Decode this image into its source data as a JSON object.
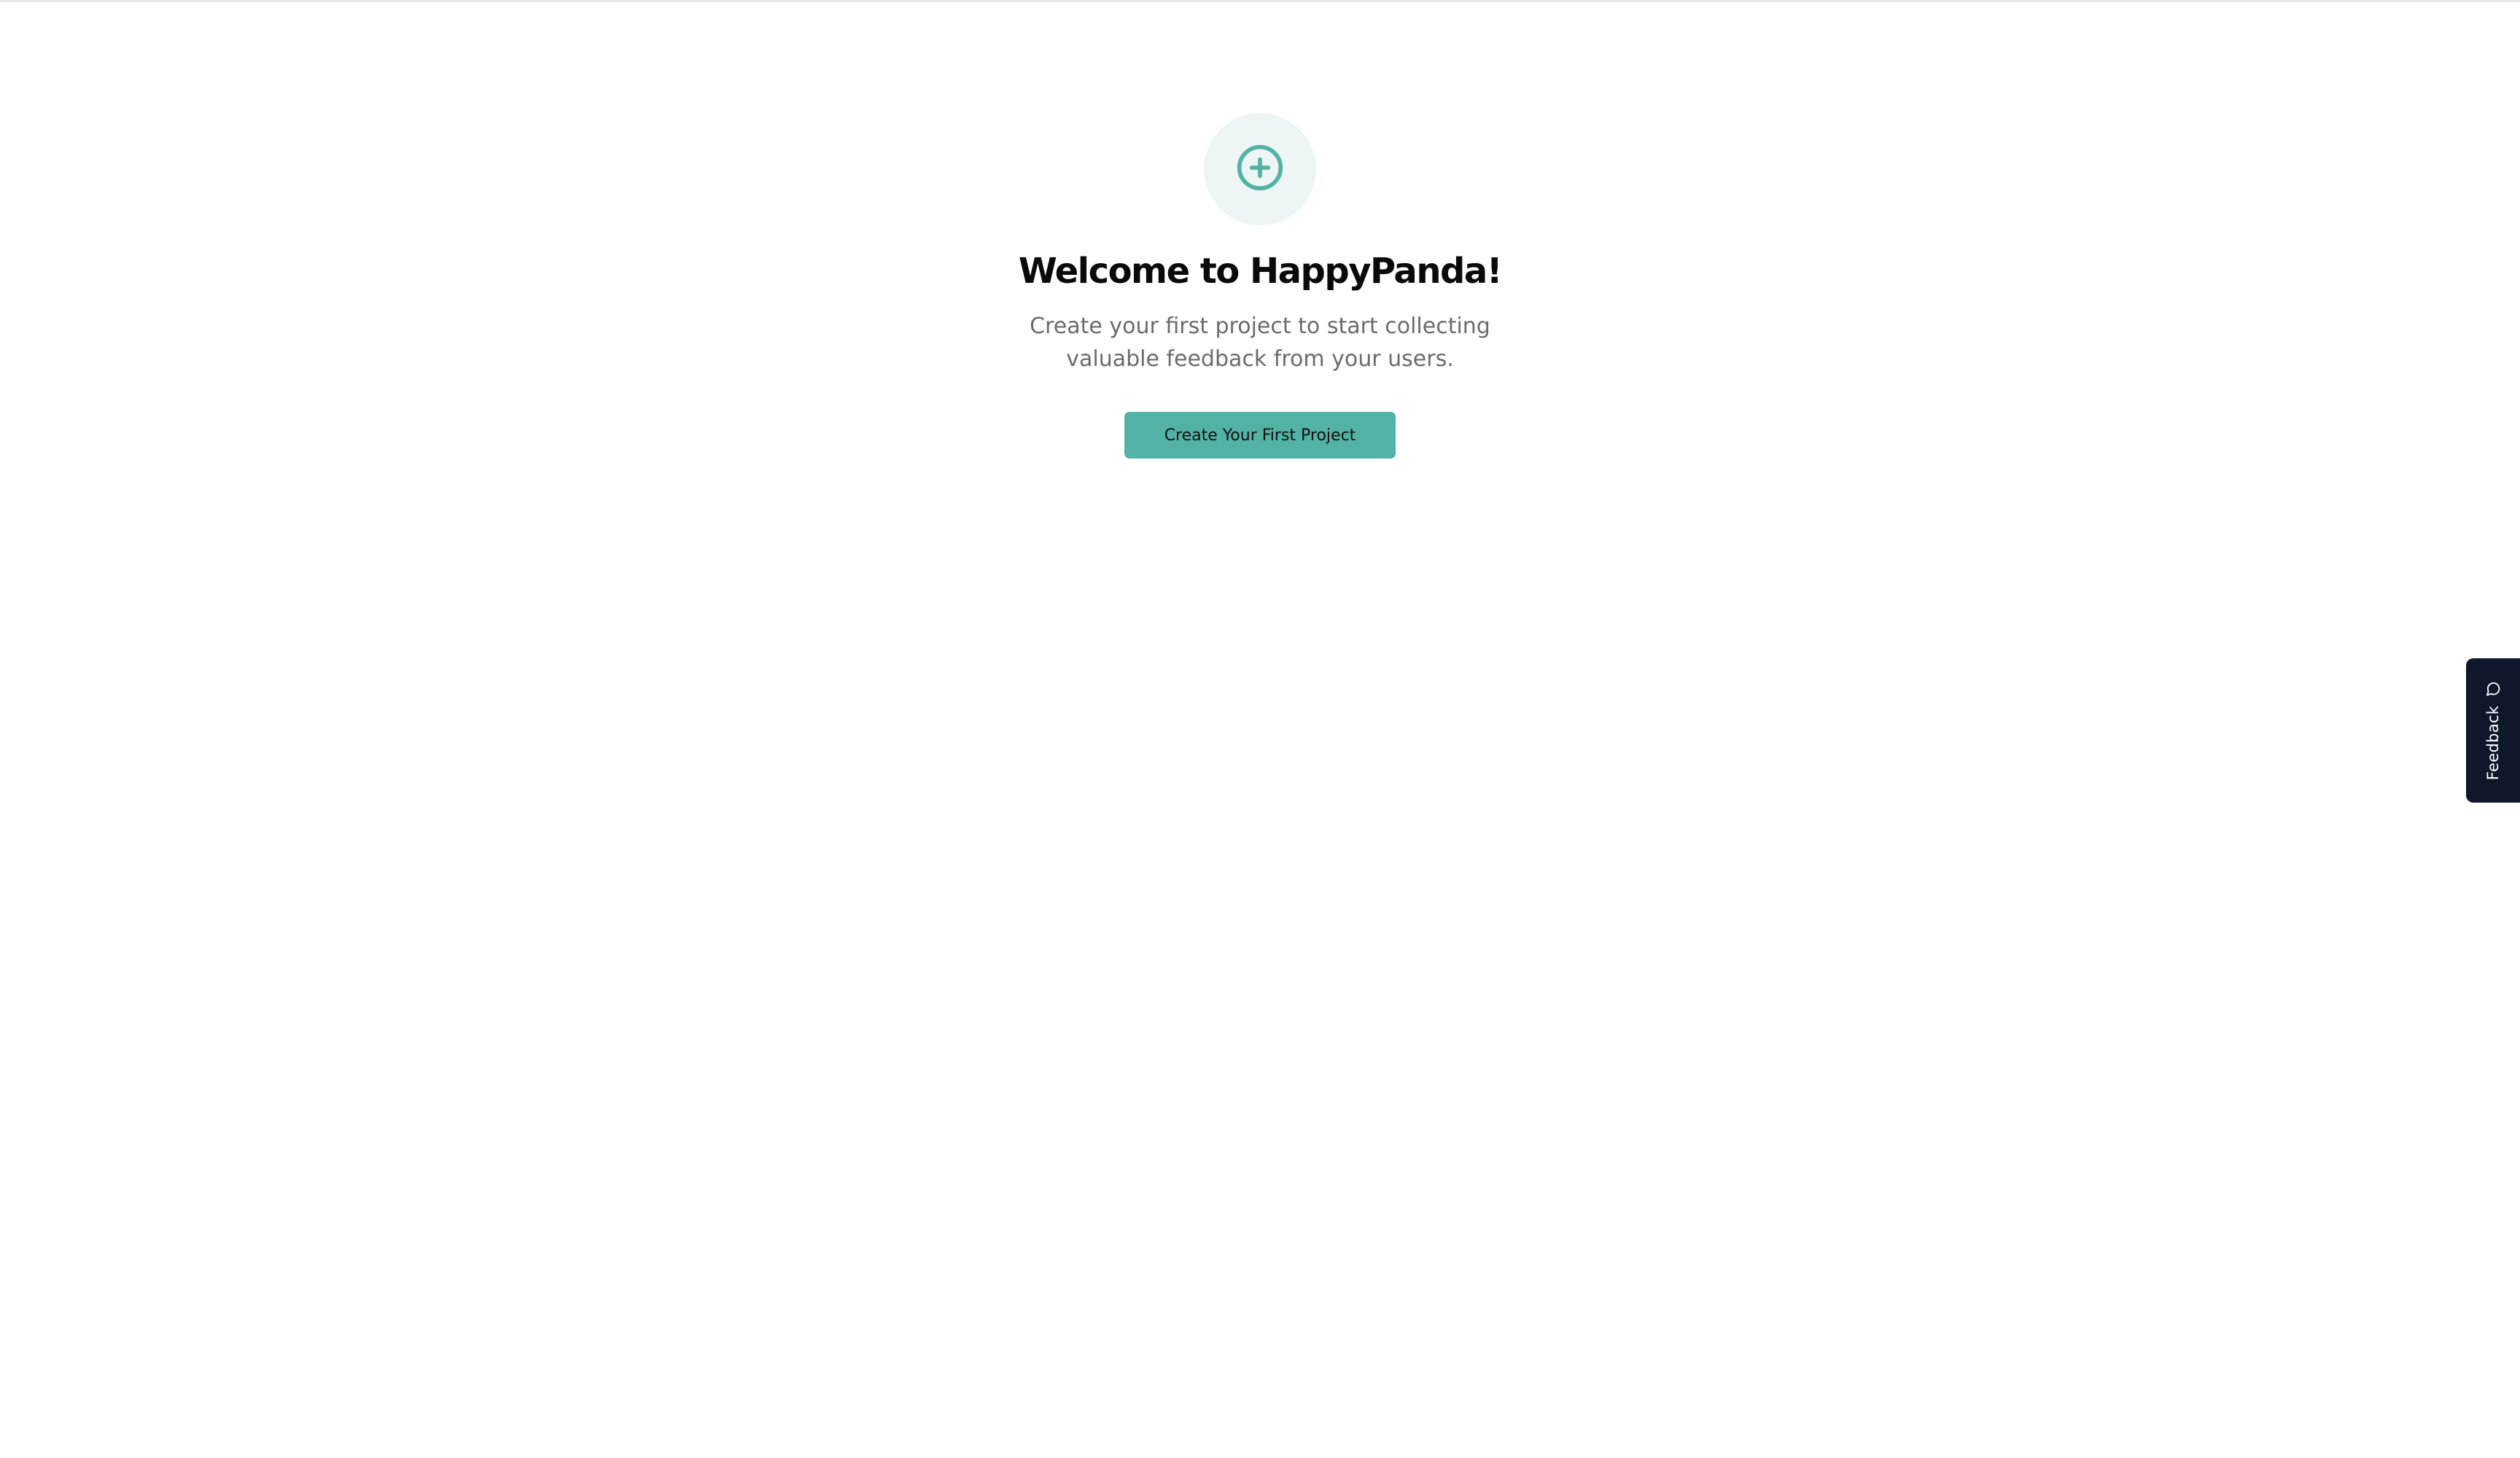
{
  "welcome": {
    "title": "Welcome to HappyPanda!",
    "subtitle": "Create your first project to start collecting valuable feedback from your users.",
    "cta_label": "Create Your First Project",
    "icon": "plus-circle-icon"
  },
  "feedback_tab": {
    "label": "Feedback",
    "icon": "message-circle-icon"
  },
  "colors": {
    "accent": "#52b3a4",
    "icon_bg": "#eef6f5",
    "feedback_tab_bg": "#0f172a"
  }
}
